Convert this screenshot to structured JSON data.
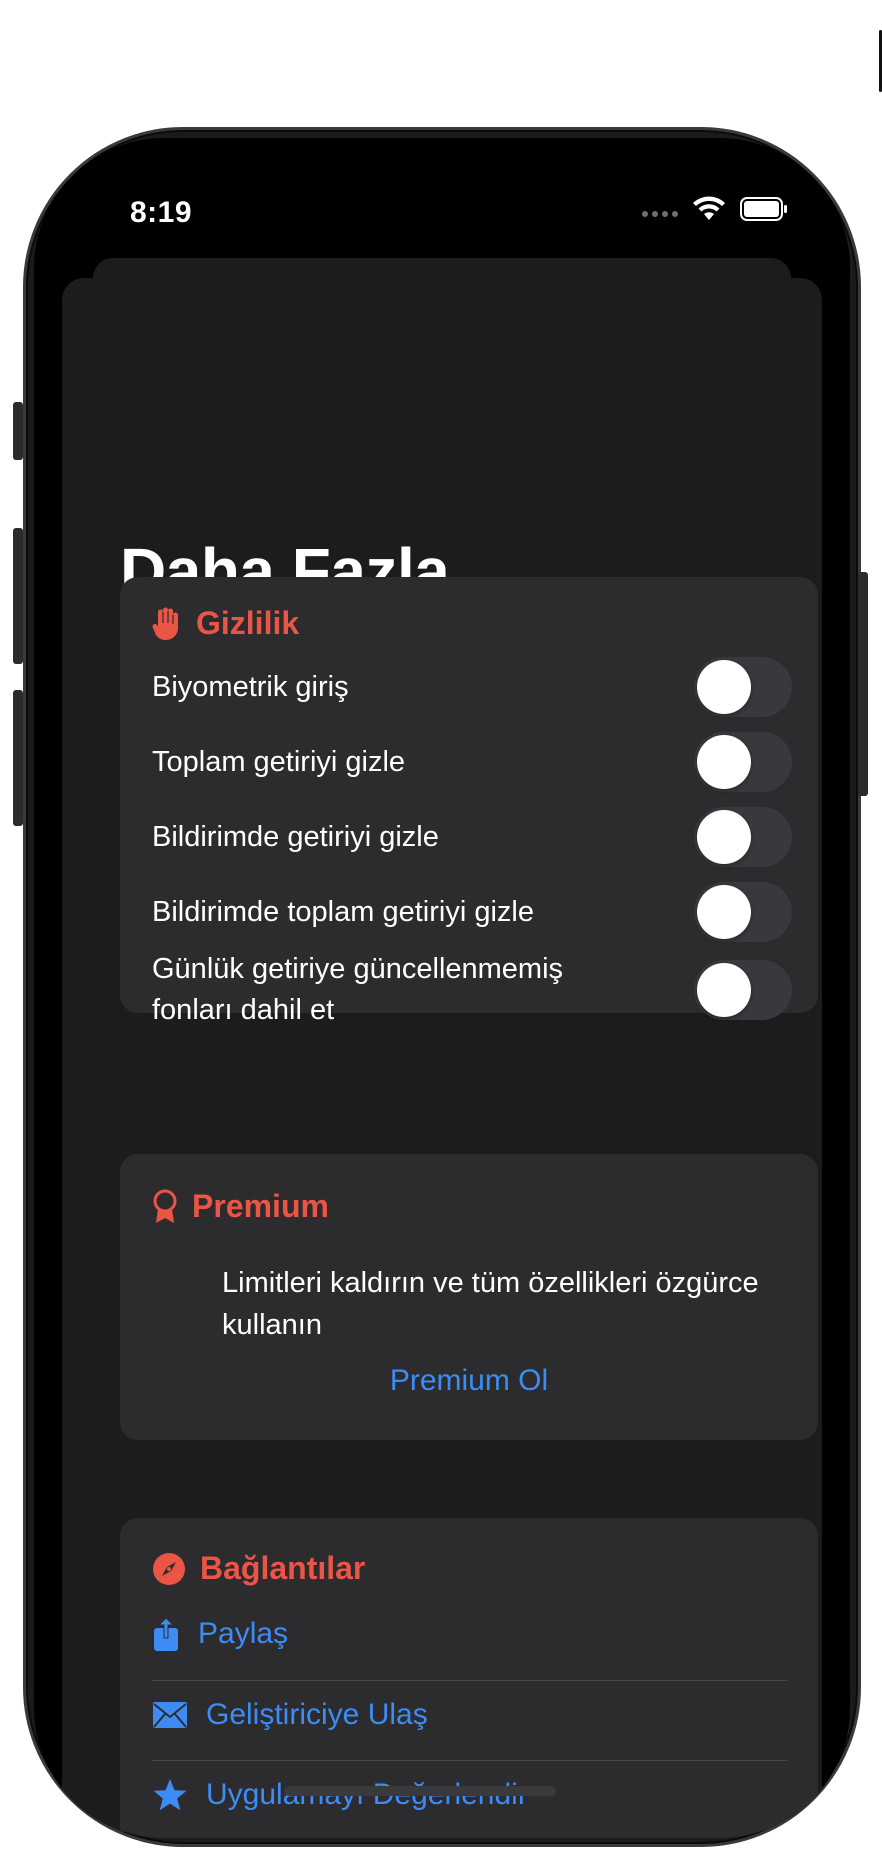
{
  "status_bar": {
    "time": "8:19"
  },
  "page": {
    "title": "Daha Fazla"
  },
  "privacy": {
    "title": "Gizlilik",
    "icon": "hand-raised-icon",
    "items": [
      {
        "label": "Biyometrik giriş",
        "on": false
      },
      {
        "label": "Toplam getiriyi gizle",
        "on": false
      },
      {
        "label": "Bildirimde getiriyi gizle",
        "on": false
      },
      {
        "label": "Bildirimde toplam getiriyi gizle",
        "on": false
      },
      {
        "label": "Günlük getiriye güncellenmemiş fonları dahil et",
        "on": false
      }
    ]
  },
  "premium": {
    "title": "Premium",
    "icon": "rosette-icon",
    "description": "Limitleri kaldırın ve tüm özellikleri özgürce kullanın",
    "button_label": "Premium Ol"
  },
  "links": {
    "title": "Bağlantılar",
    "icon": "compass-icon",
    "items": [
      {
        "label": "Paylaş",
        "icon": "share-icon"
      },
      {
        "label": "Geliştiriciye Ulaş",
        "icon": "envelope-icon"
      },
      {
        "label": "Uygulamayı Değerlendir",
        "icon": "star-icon"
      }
    ]
  },
  "colors": {
    "accent_red": "#eb5545",
    "link_blue": "#3d8cf5",
    "card_bg": "#2c2c2e",
    "sheet_bg": "#1c1c1e"
  }
}
